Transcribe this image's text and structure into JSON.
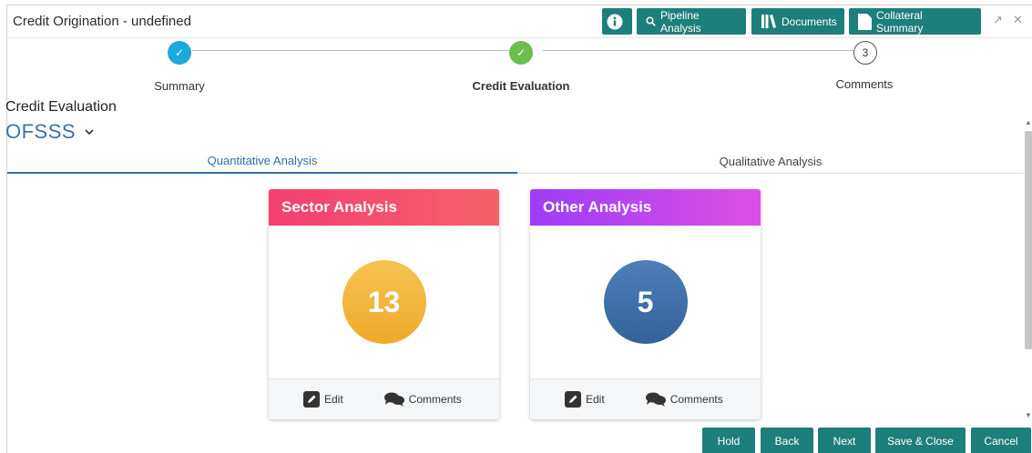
{
  "header": {
    "title": "Credit Origination - undefined",
    "pipeline_label": "Pipeline Analysis",
    "documents_label": "Documents",
    "collateral_label": "Collateral Summary"
  },
  "stepper": {
    "steps": [
      {
        "label": "Summary",
        "state": "done"
      },
      {
        "label": "Credit Evaluation",
        "state": "current"
      },
      {
        "label": "Comments",
        "number": "3",
        "state": "pending"
      }
    ]
  },
  "section": {
    "title": "Credit Evaluation",
    "entity": "OFSSS"
  },
  "tabs": [
    {
      "label": "Quantitative Analysis",
      "active": true
    },
    {
      "label": "Qualitative Analysis",
      "active": false
    }
  ],
  "cards": [
    {
      "title": "Sector Analysis",
      "count": "13",
      "edit_label": "Edit",
      "comments_label": "Comments"
    },
    {
      "title": "Other Analysis",
      "count": "5",
      "edit_label": "Edit",
      "comments_label": "Comments"
    }
  ],
  "footer": {
    "hold": "Hold",
    "back": "Back",
    "next": "Next",
    "save_close": "Save & Close",
    "cancel": "Cancel"
  },
  "colors": {
    "primary": "#1d7f7b",
    "step_done_blue": "#1fa7e0",
    "step_done_green": "#6cbf4e",
    "link_blue": "#2d6ea8"
  }
}
